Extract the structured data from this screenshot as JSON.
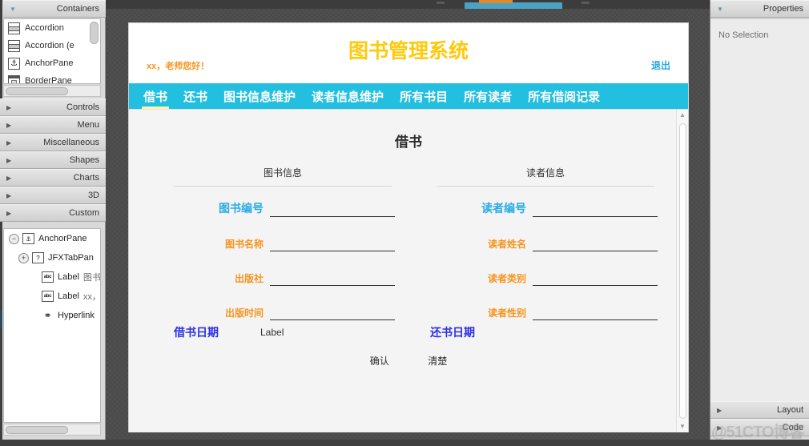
{
  "ide": {
    "library_panel": {
      "sections": [
        {
          "label": "Containers",
          "expanded": true
        },
        {
          "label": "Controls",
          "expanded": false
        },
        {
          "label": "Menu",
          "expanded": false
        },
        {
          "label": "Miscellaneous",
          "expanded": false
        },
        {
          "label": "Shapes",
          "expanded": false
        },
        {
          "label": "Charts",
          "expanded": false
        },
        {
          "label": "3D",
          "expanded": false
        },
        {
          "label": "Custom",
          "expanded": false
        }
      ],
      "container_items": [
        {
          "label": "Accordion",
          "icon": "accordion-icon"
        },
        {
          "label": "Accordion  (e",
          "icon": "accordion-icon"
        },
        {
          "label": "AnchorPane",
          "icon": "anchor-pane-icon"
        },
        {
          "label": "BorderPane",
          "icon": "border-pane-icon"
        }
      ]
    },
    "hierarchy": {
      "rows": [
        {
          "twisty": "−",
          "icon": "anchor-pane-icon",
          "icon_glyph": "⚓",
          "label": "AnchorPane",
          "sub": "",
          "indent": 0
        },
        {
          "twisty": "+",
          "icon": "unknown-node-icon",
          "icon_glyph": "?",
          "label": "JFXTabPan",
          "sub": "",
          "indent": 1
        },
        {
          "twisty": "",
          "icon": "label-icon",
          "icon_glyph": "abc",
          "label": "Label",
          "sub": "图书",
          "indent": 2
        },
        {
          "twisty": "",
          "icon": "label-icon",
          "icon_glyph": "abc",
          "label": "Label",
          "sub": "xx，",
          "indent": 2
        },
        {
          "twisty": "",
          "icon": "hyperlink-icon",
          "icon_glyph": "⚭",
          "label": "Hyperlink",
          "sub": "",
          "indent": 2
        }
      ]
    },
    "properties_panel": {
      "title": "Properties",
      "empty_text": "No Selection",
      "footer_sections": [
        {
          "label": "Layout",
          "expanded": false
        },
        {
          "label": "Code",
          "expanded": false
        }
      ]
    },
    "watermark": "@51CTO博客"
  },
  "preview": {
    "app_title": "图书管理系统",
    "greeting": "xx，老师您好！",
    "logout": "退出",
    "tabs": [
      {
        "label": "借书",
        "active": true
      },
      {
        "label": "还书",
        "active": false
      },
      {
        "label": "图书信息维护",
        "active": false
      },
      {
        "label": "读者信息维护",
        "active": false
      },
      {
        "label": "所有书目",
        "active": false
      },
      {
        "label": "所有读者",
        "active": false
      },
      {
        "label": "所有借阅记录",
        "active": false
      }
    ],
    "section_title": "借书",
    "book_group": {
      "title": "图书信息",
      "fields": [
        {
          "label": "图书编号",
          "value": "",
          "primary": true
        },
        {
          "label": "图书名称",
          "value": "",
          "primary": false
        },
        {
          "label": "出版社",
          "value": "",
          "primary": false
        },
        {
          "label": "出版时间",
          "value": "",
          "primary": false
        }
      ]
    },
    "reader_group": {
      "title": "读者信息",
      "fields": [
        {
          "label": "读者编号",
          "value": "",
          "primary": true
        },
        {
          "label": "读者姓名",
          "value": "",
          "primary": false
        },
        {
          "label": "读者类别",
          "value": "",
          "primary": false
        },
        {
          "label": "读者性别",
          "value": "",
          "primary": false
        }
      ]
    },
    "dates": {
      "borrow_label": "借书日期",
      "borrow_value": "Label",
      "return_label": "还书日期",
      "return_value": ""
    },
    "buttons": [
      {
        "label": "确认"
      },
      {
        "label": "清楚"
      }
    ],
    "colors": {
      "title_yellow": "#FFC90E",
      "tab_cyan": "#22BFE0",
      "accent_orange": "#F7941E",
      "link_blue": "#29ABE2",
      "date_blue": "#2D2DE8"
    }
  }
}
